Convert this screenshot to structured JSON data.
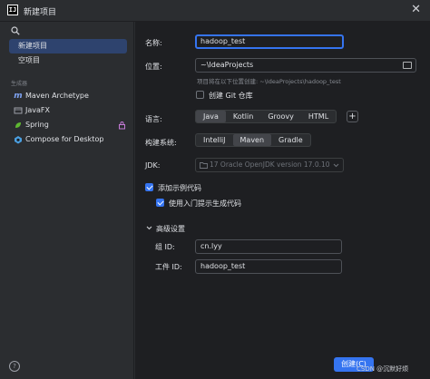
{
  "window": {
    "app_icon_text": "IJ",
    "title": "新建项目",
    "close_glyph": "✕"
  },
  "sidebar": {
    "items": [
      {
        "label": "新建项目",
        "selected": true
      },
      {
        "label": "空项目",
        "selected": false
      }
    ],
    "generators_label": "生成器",
    "generators": [
      {
        "label": "Maven Archetype",
        "icon": "maven-icon"
      },
      {
        "label": "JavaFX",
        "icon": "javafx-icon"
      },
      {
        "label": "Spring",
        "icon": "spring-icon"
      },
      {
        "label": "Compose for Desktop",
        "icon": "compose-icon"
      }
    ],
    "help_glyph": "?"
  },
  "form": {
    "name_label": "名称:",
    "name_value": "hadoop_test",
    "location_label": "位置:",
    "location_value": "~\\IdeaProjects",
    "location_hint": "项目将在以下位置创建: ~\\IdeaProjects\\hadoop_test",
    "git_label": "创建 Git 仓库",
    "git_checked": false,
    "language_label": "语言:",
    "languages": [
      "Java",
      "Kotlin",
      "Groovy",
      "HTML"
    ],
    "language_selected": "Java",
    "add_language_glyph": "+",
    "build_label": "构建系统:",
    "build_systems": [
      "IntelliJ",
      "Maven",
      "Gradle"
    ],
    "build_selected": "Maven",
    "jdk_label": "JDK:",
    "jdk_value": "17 Oracle OpenJDK version 17.0.10",
    "sample_code_label": "添加示例代码",
    "sample_code_checked": true,
    "onboarding_label": "使用入门提示生成代码",
    "onboarding_checked": true,
    "advanced_label": "高级设置",
    "group_id_label": "组 ID:",
    "group_id_value": "cn.lyy",
    "artifact_id_label": "工件 ID:",
    "artifact_id_value": "hadoop_test"
  },
  "footer": {
    "create_label": "创建(C)",
    "watermark": "CSDN @沉默好烦"
  },
  "colors": {
    "accent": "#3574f0",
    "selection": "#2e436e",
    "background": "#1e1f22",
    "panel": "#2b2d30"
  }
}
